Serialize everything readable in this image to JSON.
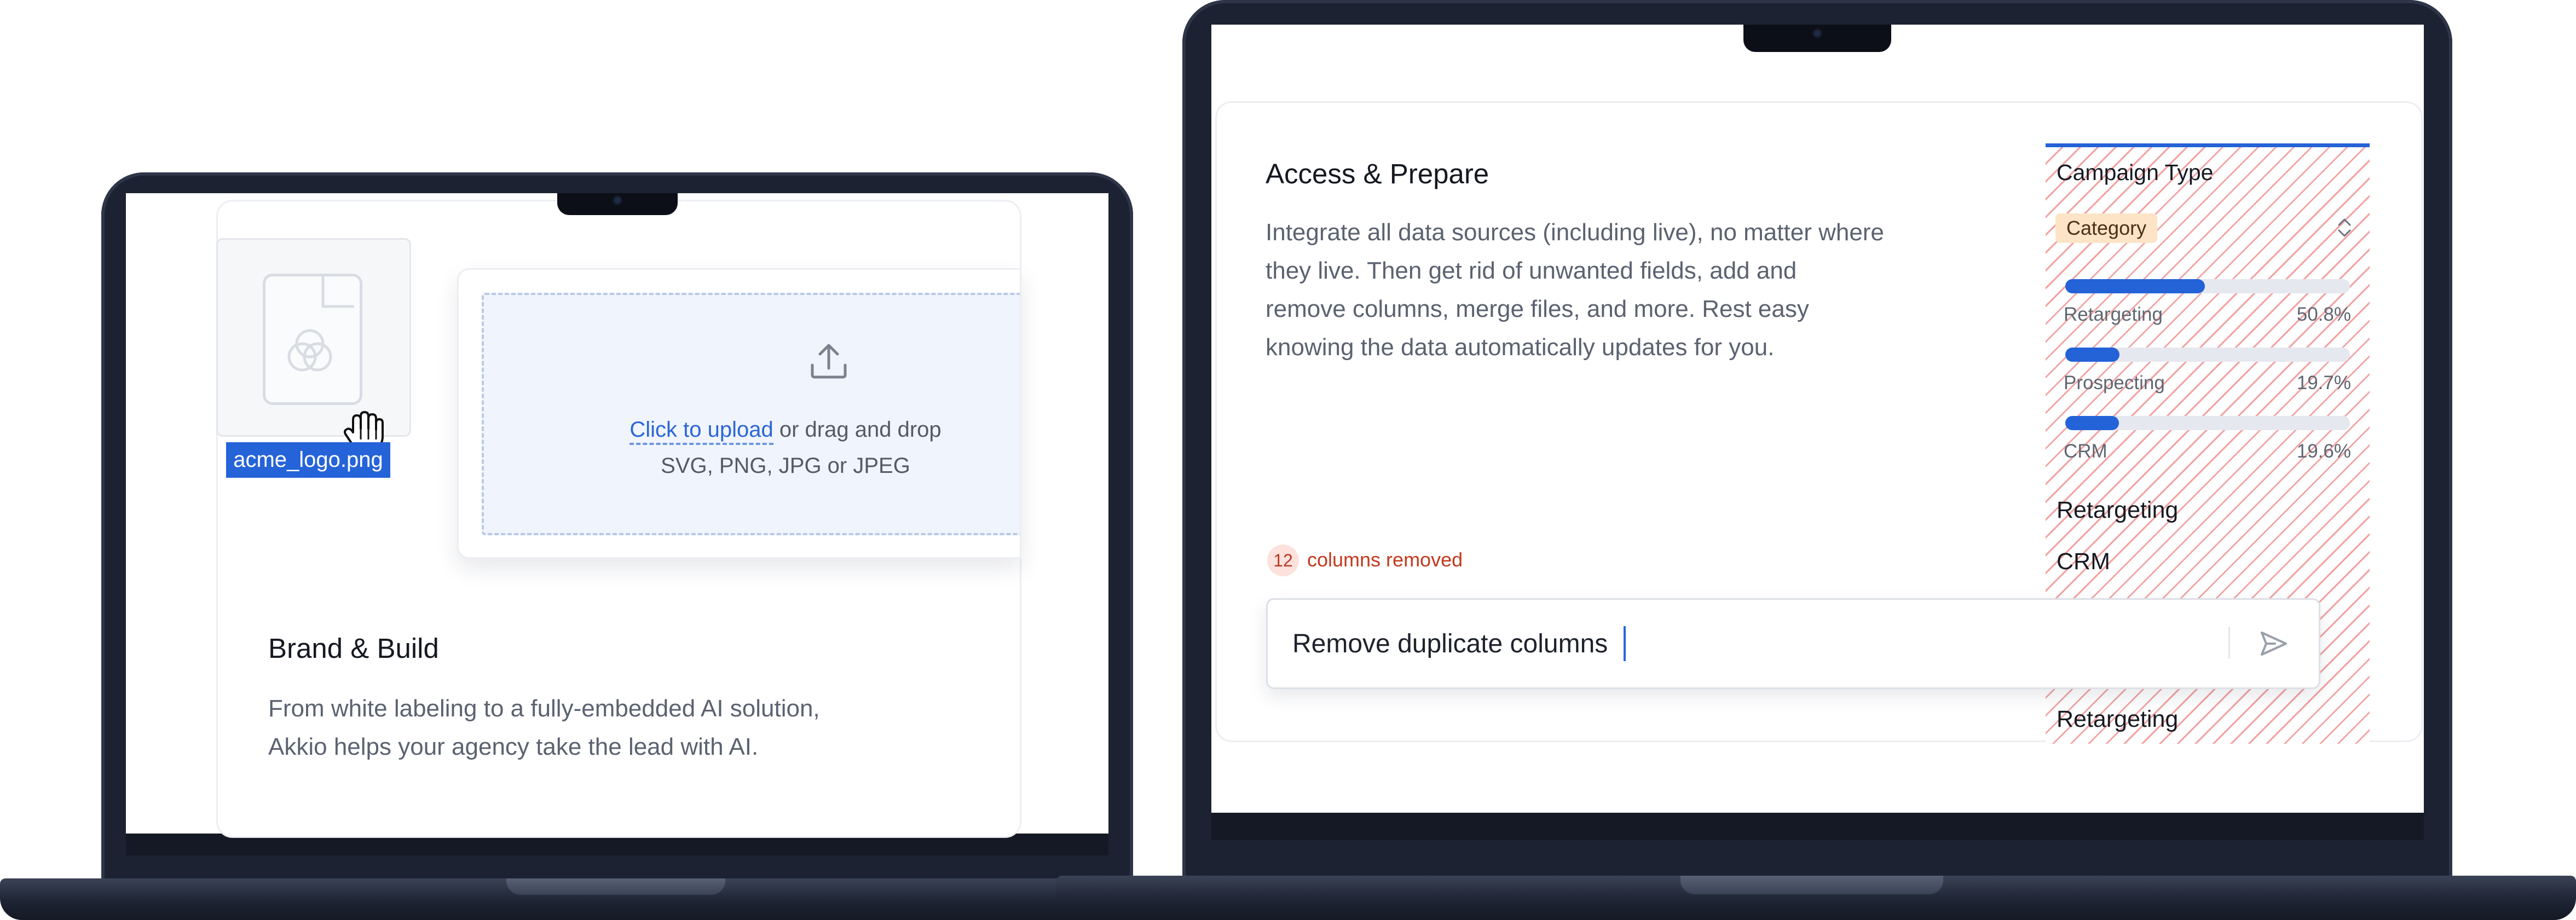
{
  "left_card": {
    "file_name": "acme_logo.png",
    "upload_link": "Click to upload",
    "upload_rest": " or drag and drop",
    "upload_formats": "SVG, PNG, JPG or JPEG",
    "title": "Brand & Build",
    "body_line1": "From white labeling to a fully-embedded AI solution,",
    "body_line2": "Akkio helps your agency take the lead with AI."
  },
  "right_card": {
    "title": "Access & Prepare",
    "body_line1": "Integrate all data sources (including live), no matter where",
    "body_line2": "they live. Then get rid of unwanted fields, add and",
    "body_line3": "remove columns, merge files, and more. Rest easy",
    "body_line4": "knowing the data automatically updates for you.",
    "removed_count": "12",
    "removed_label": "columns removed",
    "prompt_value": "Remove duplicate columns",
    "prompt_placeholder": ""
  },
  "panel": {
    "title": "Campaign Type",
    "chip": "Category",
    "bars": [
      {
        "label": "Retargeting",
        "pct": "50.8%",
        "fraction": 0.508
      },
      {
        "label": "Prospecting",
        "pct": "19.7%",
        "fraction": 0.197
      },
      {
        "label": "CRM",
        "pct": "19.6%",
        "fraction": 0.196
      }
    ],
    "items": [
      "Retargeting",
      "CRM",
      "Retargeting"
    ]
  },
  "colors": {
    "accent": "#2462d8",
    "warning": "#c2391d",
    "chip_bg": "#fde4c6",
    "laptop": "#1c2232"
  },
  "icons": {
    "upload": "upload-icon",
    "file": "file-image-icon",
    "cursor": "grab-hand-cursor-icon",
    "send": "send-icon",
    "sort": "chevron-up-down-icon"
  }
}
